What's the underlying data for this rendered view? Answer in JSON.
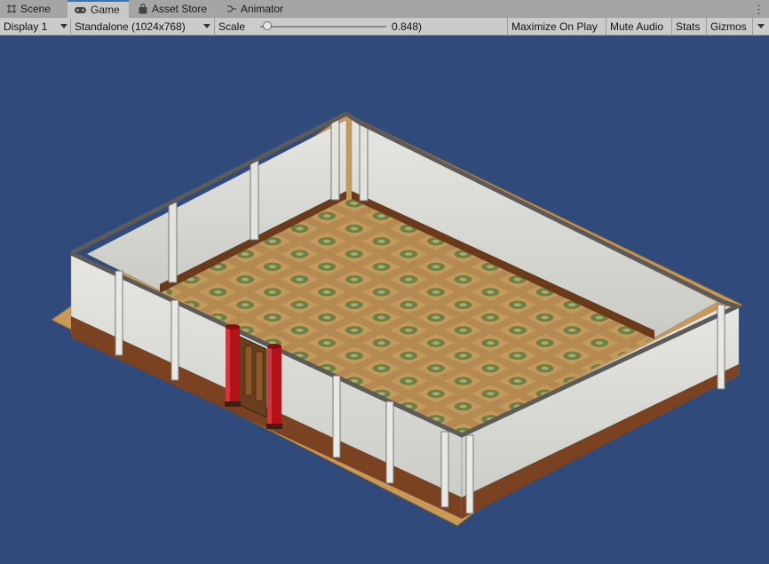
{
  "tabs": [
    {
      "label": "Scene",
      "icon": "grid-icon",
      "active": false
    },
    {
      "label": "Game",
      "icon": "gamepad-icon",
      "active": true
    },
    {
      "label": "Asset Store",
      "icon": "bag-icon",
      "active": false
    },
    {
      "label": "Animator",
      "icon": "animator-icon",
      "active": false
    }
  ],
  "toolbar": {
    "display": "Display 1",
    "resolution": "Standalone (1024x768)",
    "scale_label": "Scale",
    "scale_value": "0.848)",
    "scale_fraction": 0.04,
    "maximize": "Maximize On Play",
    "mute": "Mute Audio",
    "stats": "Stats",
    "gizmos": "Gizmos"
  },
  "colors": {
    "accent": "#3a72b0",
    "viewport_bg": "#2f4a7b",
    "floor": "#b98f55",
    "wall": "#dcdcd8",
    "pillar_red": "#b0141a"
  }
}
